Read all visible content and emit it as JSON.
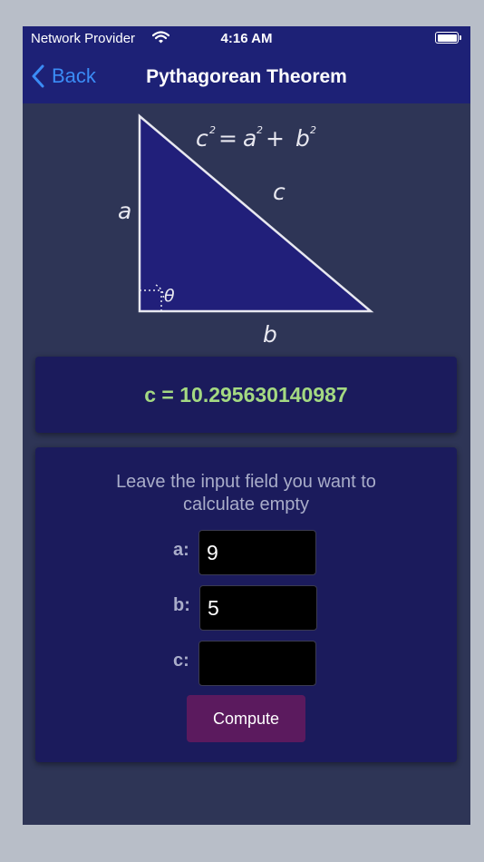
{
  "status_bar": {
    "carrier": "Network Provider",
    "time": "4:16 AM"
  },
  "nav": {
    "back_label": "Back",
    "title": "Pythagorean Theorem"
  },
  "diagram": {
    "formula_c": "c",
    "formula_eq": "=",
    "formula_a": "a",
    "formula_plus": "+",
    "formula_b": "b",
    "superscript": "2",
    "side_a": "a",
    "side_b": "b",
    "side_c": "c",
    "angle": "θ"
  },
  "result": {
    "text": "c = 10.295630140987"
  },
  "form": {
    "instruction": "Leave the input field you want to calculate empty",
    "label_a": "a:",
    "label_b": "b:",
    "label_c": "c:",
    "value_a": "9",
    "value_b": "5",
    "value_c": "",
    "compute_label": "Compute"
  },
  "colors": {
    "background": "#2e3556",
    "nav": "#1d2176",
    "card": "#1b1b5c",
    "triangle_fill": "#211f7a",
    "result_text": "#a4d982",
    "back_link": "#3b8cf6",
    "compute_button": "#5b1a5e"
  },
  "icons": [
    "wifi-icon",
    "battery-icon",
    "chevron-left-icon"
  ]
}
